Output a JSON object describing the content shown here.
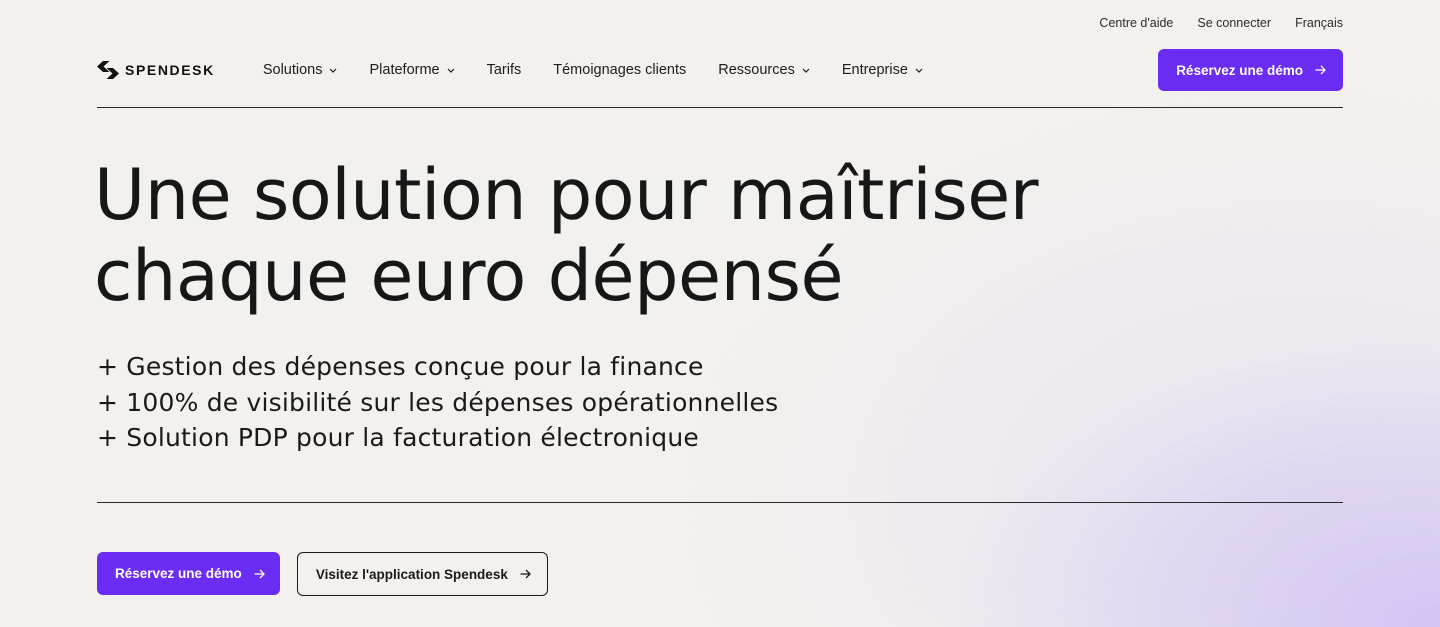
{
  "utility_nav": {
    "help": "Centre d'aide",
    "login": "Se connecter",
    "language": "Français"
  },
  "brand": {
    "name": "SPENDESK"
  },
  "menu": [
    {
      "label": "Solutions",
      "has_dropdown": true
    },
    {
      "label": "Plateforme",
      "has_dropdown": true
    },
    {
      "label": "Tarifs",
      "has_dropdown": false
    },
    {
      "label": "Témoignages clients",
      "has_dropdown": false
    },
    {
      "label": "Ressources",
      "has_dropdown": true
    },
    {
      "label": "Entreprise",
      "has_dropdown": true
    }
  ],
  "header_cta": {
    "label": "Réservez une démo"
  },
  "hero": {
    "title_line1": "Une solution pour maîtriser",
    "title_line2": "chaque euro dépensé",
    "points": [
      "+ Gestion des dépenses conçue pour la finance",
      "+ 100% de visibilité sur les dépenses opérationnelles",
      "+ Solution PDP pour la facturation électronique"
    ]
  },
  "cta": {
    "primary": "Réservez une démo",
    "secondary": "Visitez l'application Spendesk"
  },
  "colors": {
    "accent": "#6b2df3",
    "background": "#f2f1ee",
    "text": "#1a1a1a"
  },
  "icons": {
    "logo": "spendesk-logo-icon",
    "dropdown": "chevron-down-icon",
    "arrow": "arrow-right-icon"
  }
}
